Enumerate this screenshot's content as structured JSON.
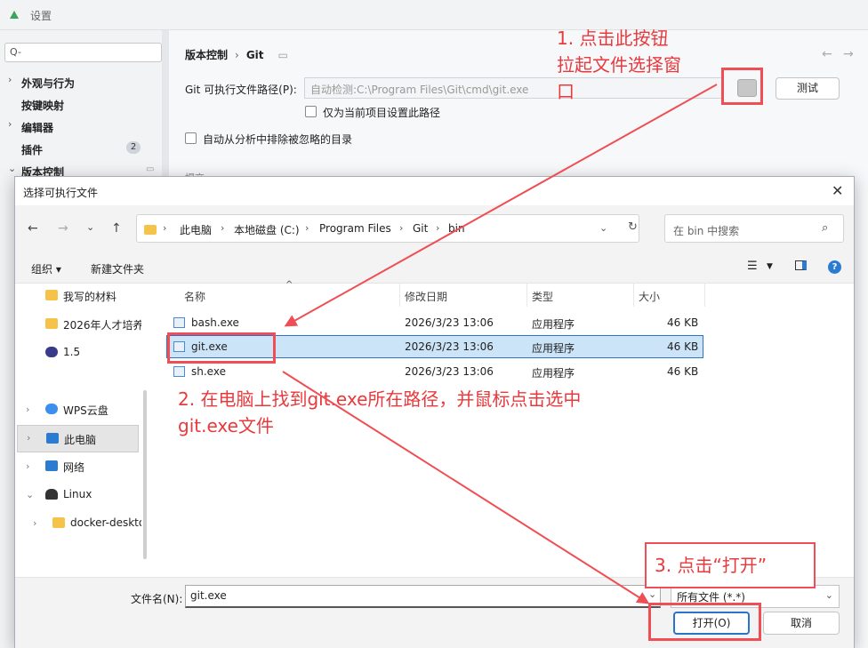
{
  "settings_window": {
    "title": "设置",
    "search_placeholder": "Q-",
    "sidebar_items": [
      {
        "arrow": "›",
        "label": "外观与行为"
      },
      {
        "arrow": "",
        "label": "按键映射"
      },
      {
        "arrow": "›",
        "label": "编辑器"
      },
      {
        "arrow": "",
        "label": "插件",
        "badge": "2"
      },
      {
        "arrow": "⌄",
        "label": "版本控制"
      }
    ],
    "breadcrumb": {
      "part1": "版本控制",
      "sep": "›",
      "part2": "Git"
    },
    "git_path_label": "Git 可执行文件路径(P):",
    "git_path_value": "自动检测:C:\\Program Files\\Git\\cmd\\git.exe",
    "test_button": "测试",
    "checkbox_project_only": "仅为当前项目设置此路径",
    "checkbox_auto_exclude": "自动从分析中排除被忽略的目录",
    "partial_section_label": "提交"
  },
  "file_dialog": {
    "title": "选择可执行文件",
    "path_segments": [
      "此电脑",
      "本地磁盘 (C:)",
      "Program Files",
      "Git",
      "bin"
    ],
    "search_placeholder": "在 bin 中搜索",
    "organize": "组织 ▾",
    "new_folder": "新建文件夹",
    "help_label": "?",
    "left_tree": [
      {
        "label": "我写的材料",
        "icon_color": "#f5c34a",
        "arrow": ""
      },
      {
        "label": "2026年人才培养",
        "icon_color": "#f5c34a",
        "arrow": ""
      },
      {
        "label": "1.5",
        "icon_color": "#3a3a8a",
        "arrow": ""
      },
      {
        "label": "WPS云盘",
        "icon_color": "#3c8ef0",
        "arrow": "›"
      },
      {
        "label": "此电脑",
        "icon_color": "#2b7bd3",
        "arrow": "›"
      },
      {
        "label": "网络",
        "icon_color": "#2b7bd3",
        "arrow": "›"
      },
      {
        "label": "Linux",
        "icon_color": "#333333",
        "arrow": "⌄"
      },
      {
        "label": "docker-desktop",
        "icon_color": "#f5c34a",
        "arrow": "›"
      }
    ],
    "columns": {
      "name": "名称",
      "date": "修改日期",
      "type": "类型",
      "size": "大小"
    },
    "files": [
      {
        "name": "bash.exe",
        "date": "2026/3/23 13:06",
        "type": "应用程序",
        "size": "46 KB"
      },
      {
        "name": "git.exe",
        "date": "2026/3/23 13:06",
        "type": "应用程序",
        "size": "46 KB"
      },
      {
        "name": "sh.exe",
        "date": "2026/3/23 13:06",
        "type": "应用程序",
        "size": "46 KB"
      }
    ],
    "filename_label": "文件名(N):",
    "filename_value": "git.exe",
    "filetype_value": "所有文件 (*.*)",
    "open_button": "打开(O)",
    "cancel_button": "取消"
  },
  "annotations": {
    "step1_line1": "1. 点击此按钮",
    "step1_line2": "拉起文件选择窗",
    "step1_line3": "口",
    "step2_line1": "2. 在电脑上找到git.exe所在路径，并鼠标点击选中",
    "step2_line2": "git.exe文件",
    "step3": "3. 点击“打开”",
    "color": "#e8393d"
  }
}
